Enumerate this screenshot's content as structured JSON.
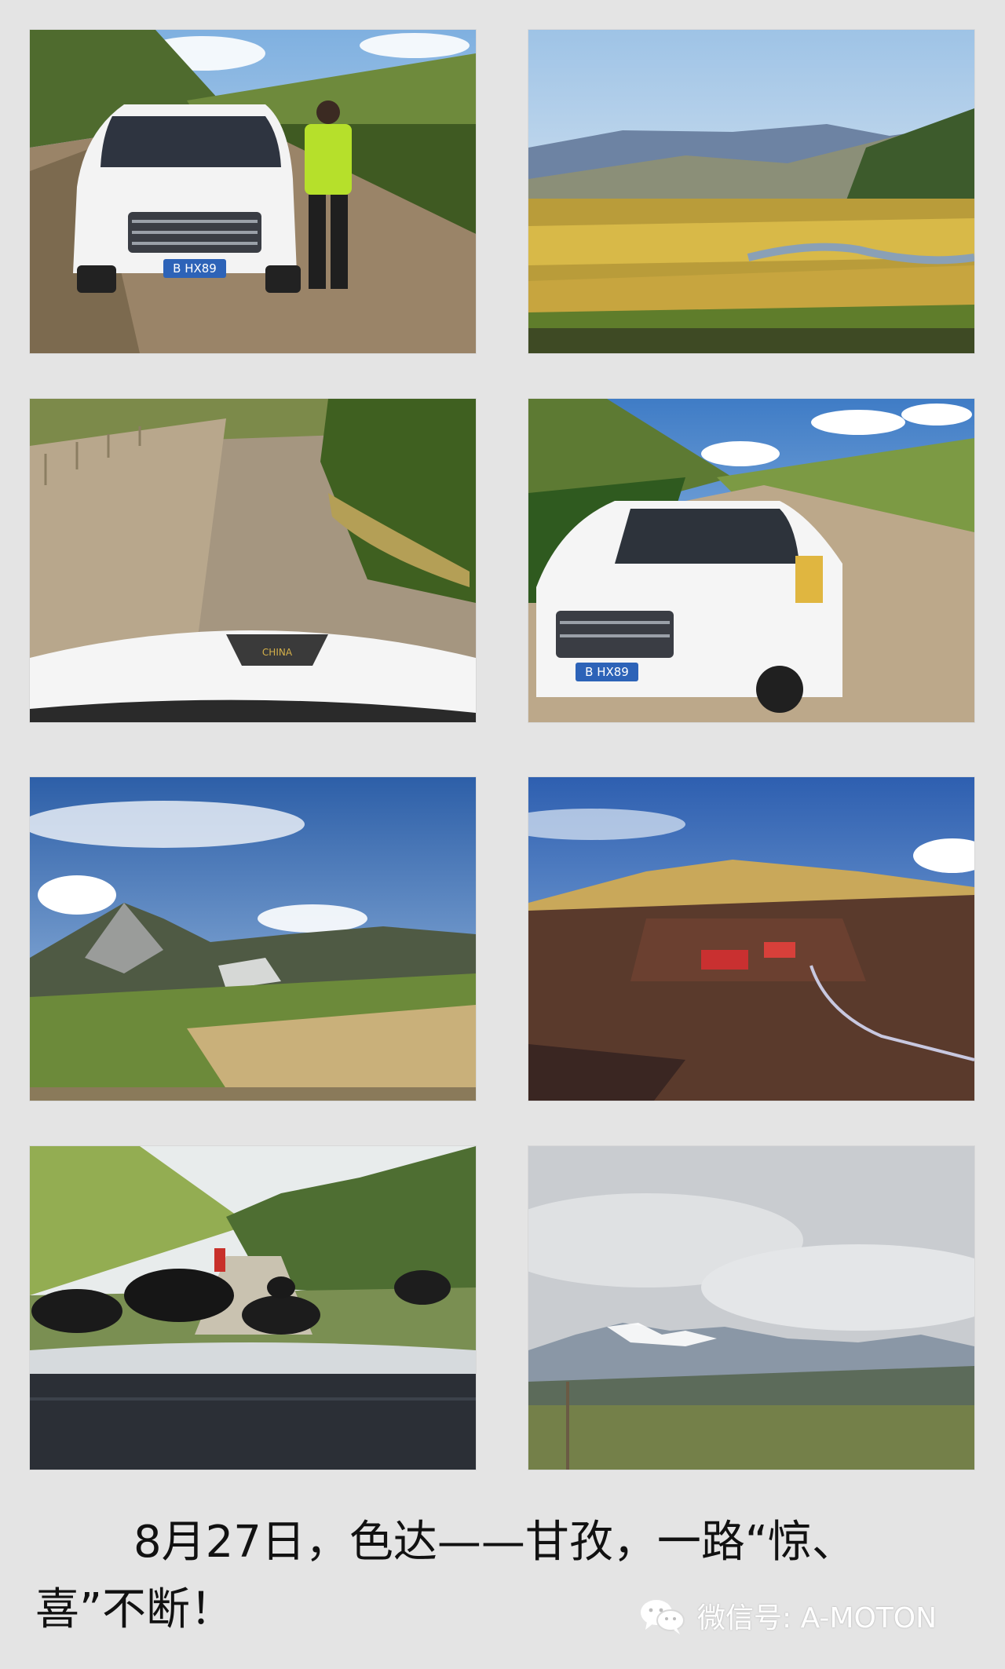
{
  "photos": [
    {
      "id": "p1",
      "subject": "white-suv-with-driver-on-dirt-road",
      "plate": "B HX89"
    },
    {
      "id": "p2",
      "subject": "river-valley-with-golden-fields"
    },
    {
      "id": "p3",
      "subject": "muddy-dirt-road-from-car-hood",
      "hood_emblem": "CHINA"
    },
    {
      "id": "p4",
      "subject": "white-suv-on-mountain-road",
      "plate": "B HX89"
    },
    {
      "id": "p5",
      "subject": "rocky-mountain-peak-under-blue-sky"
    },
    {
      "id": "p6",
      "subject": "monastery-valley-with-red-huts"
    },
    {
      "id": "p7",
      "subject": "yaks-on-road-through-windshield"
    },
    {
      "id": "p8",
      "subject": "snow-capped-mountains-under-clouds"
    }
  ],
  "caption": {
    "line1": "8月27日，色达——甘孜，一路“惊、",
    "line2": "喜”不断！"
  },
  "watermark": {
    "label": "微信号: A-MOTON",
    "icon": "wechat-icon"
  },
  "colors": {
    "background": "#e4e4e4",
    "caption_text": "#111111",
    "watermark_text": "#ffffff"
  }
}
